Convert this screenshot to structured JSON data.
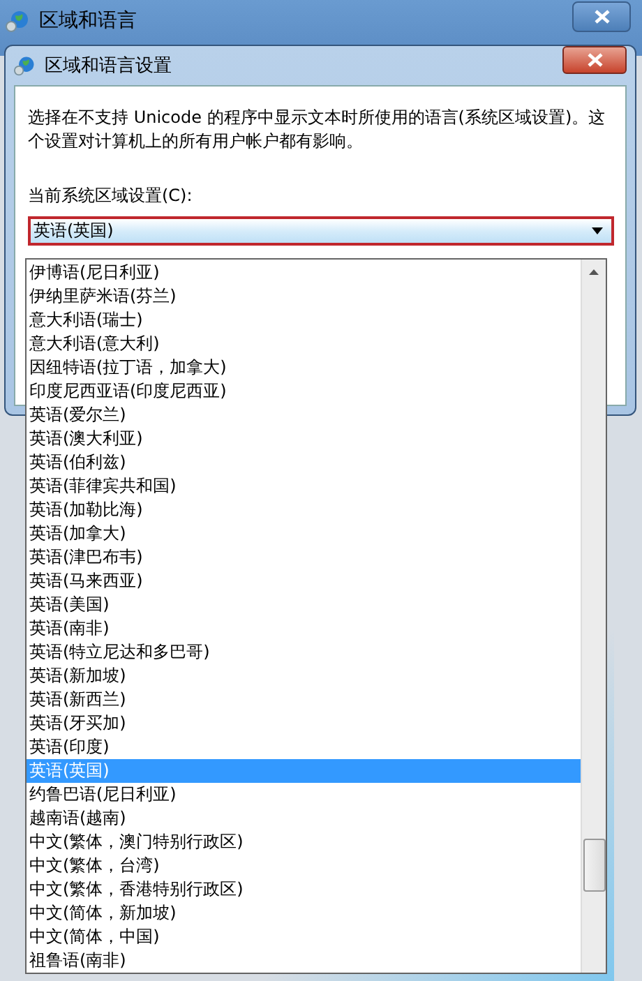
{
  "window": {
    "title": "区域和语言"
  },
  "dialog": {
    "title": "区域和语言设置",
    "description": "选择在不支持 Unicode 的程序中显示文本时所使用的语言(系统区域设置)。这个设置对计算机上的所有用户帐户都有影响。",
    "field_label": "当前系统区域设置(C):",
    "combo": {
      "value": "英语(英国)"
    },
    "dropdown_items": [
      {
        "label": "伊博语(尼日利亚)",
        "selected": false
      },
      {
        "label": "伊纳里萨米语(芬兰)",
        "selected": false
      },
      {
        "label": "意大利语(瑞士)",
        "selected": false
      },
      {
        "label": "意大利语(意大利)",
        "selected": false
      },
      {
        "label": "因纽特语(拉丁语，加拿大)",
        "selected": false
      },
      {
        "label": "印度尼西亚语(印度尼西亚)",
        "selected": false
      },
      {
        "label": "英语(爱尔兰)",
        "selected": false
      },
      {
        "label": "英语(澳大利亚)",
        "selected": false
      },
      {
        "label": "英语(伯利兹)",
        "selected": false
      },
      {
        "label": "英语(菲律宾共和国)",
        "selected": false
      },
      {
        "label": "英语(加勒比海)",
        "selected": false
      },
      {
        "label": "英语(加拿大)",
        "selected": false
      },
      {
        "label": "英语(津巴布韦)",
        "selected": false
      },
      {
        "label": "英语(马来西亚)",
        "selected": false
      },
      {
        "label": "英语(美国)",
        "selected": false
      },
      {
        "label": "英语(南非)",
        "selected": false
      },
      {
        "label": "英语(特立尼达和多巴哥)",
        "selected": false
      },
      {
        "label": "英语(新加坡)",
        "selected": false
      },
      {
        "label": "英语(新西兰)",
        "selected": false
      },
      {
        "label": "英语(牙买加)",
        "selected": false
      },
      {
        "label": "英语(印度)",
        "selected": false
      },
      {
        "label": "英语(英国)",
        "selected": true
      },
      {
        "label": "约鲁巴语(尼日利亚)",
        "selected": false
      },
      {
        "label": "越南语(越南)",
        "selected": false
      },
      {
        "label": "中文(繁体，澳门特别行政区)",
        "selected": false
      },
      {
        "label": "中文(繁体，台湾)",
        "selected": false
      },
      {
        "label": "中文(繁体，香港特别行政区)",
        "selected": false
      },
      {
        "label": "中文(简体，新加坡)",
        "selected": false
      },
      {
        "label": "中文(简体，中国)",
        "selected": false
      },
      {
        "label": "祖鲁语(南非)",
        "selected": false
      }
    ]
  }
}
